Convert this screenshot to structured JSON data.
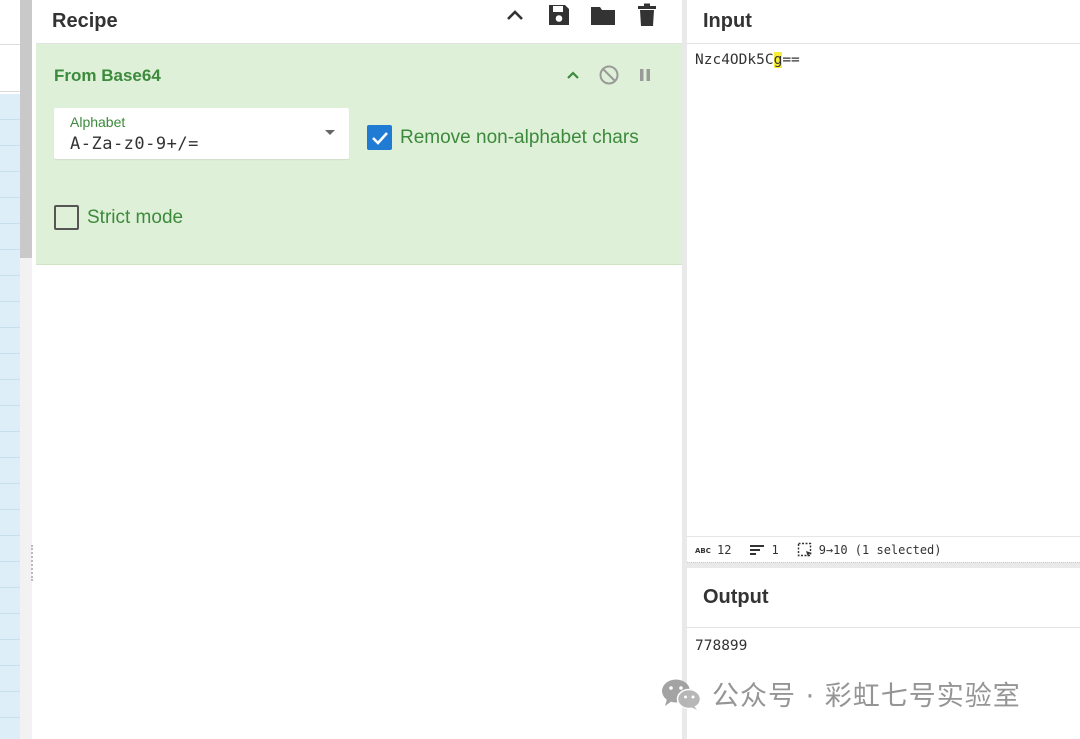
{
  "recipe": {
    "title": "Recipe",
    "actions": [
      "chevron-up-icon",
      "save-icon",
      "folder-icon",
      "trash-icon"
    ],
    "operation": {
      "title": "From Base64",
      "controls": [
        "chevron-up-icon",
        "disable-icon",
        "pause-icon"
      ],
      "alphabet": {
        "label": "Alphabet",
        "value": "A-Za-z0-9+/="
      },
      "remove_non_alphabet": {
        "label": "Remove non-alphabet chars",
        "checked": true
      },
      "strict_mode": {
        "label": "Strict mode",
        "checked": false
      }
    }
  },
  "input": {
    "title": "Input",
    "text_before": "Nzc4ODk5C",
    "text_highlight": "g",
    "text_after": "==",
    "status": {
      "length": "12",
      "lines": "1",
      "selection": "9→10 (1 selected)"
    }
  },
  "output": {
    "title": "Output",
    "text": "778899"
  },
  "watermark": {
    "text": "公众号 · 彩虹七号实验室"
  },
  "colors": {
    "op_background": "#dff0d8",
    "op_text": "#3c8a3c",
    "checkbox_on": "#1f7bd4",
    "highlight": "#f7ec3a"
  }
}
